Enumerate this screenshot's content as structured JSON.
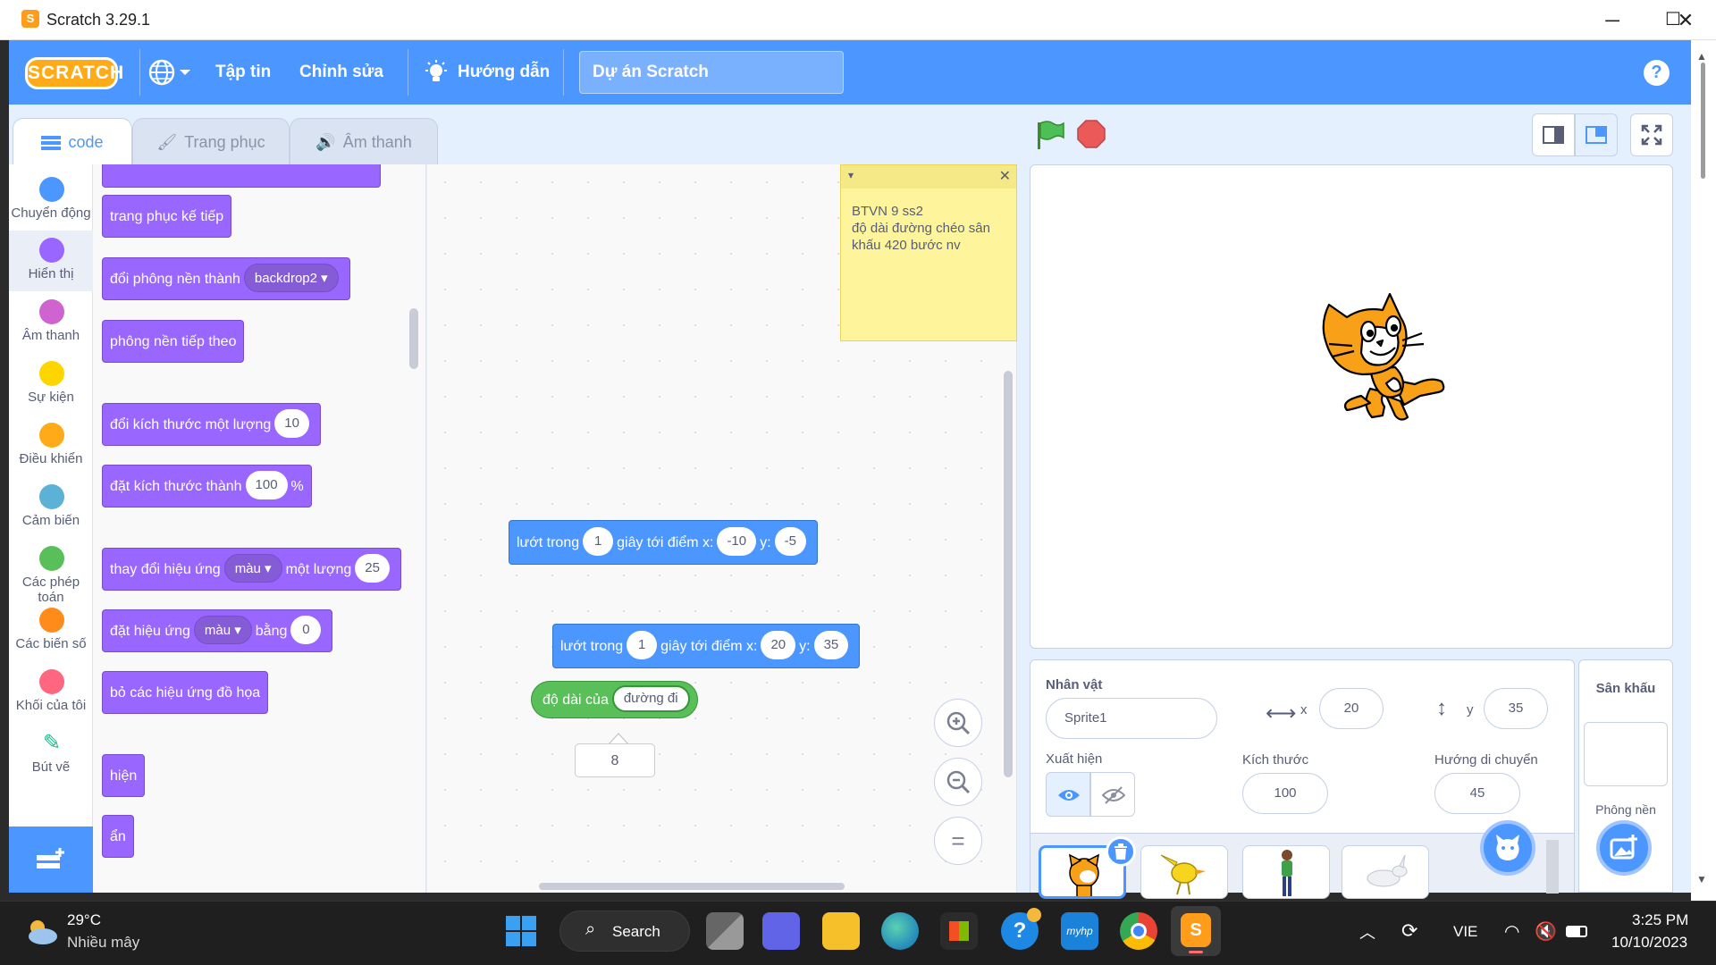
{
  "window": {
    "title": "Scratch 3.29.1",
    "minimize": "─",
    "maximize": "☐",
    "close": "✕"
  },
  "menubar": {
    "logo": "SCRATCH",
    "file": "Tập tin",
    "edit": "Chỉnh sửa",
    "tutorials": "Hướng dẫn",
    "project_title": "Dự án Scratch",
    "help": "?"
  },
  "tabs": {
    "code": "code",
    "costumes": "Trang phục",
    "sounds": "Âm thanh"
  },
  "categories": [
    {
      "label": "Chuyển động",
      "color": "#4c97ff"
    },
    {
      "label": "Hiển thị",
      "color": "#9966ff"
    },
    {
      "label": "Âm thanh",
      "color": "#cf63cf"
    },
    {
      "label": "Sự kiện",
      "color": "#ffd500"
    },
    {
      "label": "Điều khiển",
      "color": "#ffab19"
    },
    {
      "label": "Cảm biến",
      "color": "#5cb1d6"
    },
    {
      "label": "Các phép toán",
      "color": "#59c059"
    },
    {
      "label": "Các biến số",
      "color": "#ff8c1a"
    },
    {
      "label": "Khối của tôi",
      "color": "#ff6680"
    },
    {
      "label": "Bút vẽ",
      "color": "#0fbd8c"
    }
  ],
  "palette": {
    "next_costume": "trang phục kế tiếp",
    "switch_backdrop": "đổi phông nền thành",
    "backdrop_value": "backdrop2",
    "next_backdrop": "phông nền tiếp theo",
    "change_size": "đổi kích thước một lượng",
    "change_size_value": "10",
    "set_size": "đặt kích thước thành",
    "set_size_value": "100",
    "set_size_unit": "%",
    "change_effect": "thay đổi hiệu ứng",
    "effect_color": "màu",
    "change_effect_by": "một lượng",
    "change_effect_value": "25",
    "set_effect": "đặt hiệu ứng",
    "set_effect_to": "bằng",
    "set_effect_value": "0",
    "clear_effects": "bỏ các hiệu ứng đồ họa",
    "show": "hiện",
    "hide": "ẩn"
  },
  "workspace": {
    "note_text": "BTVN 9 ss2\nđộ dài đường chéo sân khấu 420 bước nv",
    "glide1": {
      "prefix": "lướt trong",
      "secs": "1",
      "mid": "giây tới điểm x:",
      "x": "-10",
      "ylabel": "y:",
      "y": "-5"
    },
    "glide2": {
      "prefix": "lướt trong",
      "secs": "1",
      "mid": "giây tới điểm x:",
      "x": "20",
      "ylabel": "y:",
      "y": "35"
    },
    "length_block": {
      "label": "độ dài của",
      "value": "đường đi"
    },
    "result_bubble": "8",
    "zoom_in": "+",
    "zoom_out": "−",
    "zoom_reset": "="
  },
  "sprite_info": {
    "sprite_label": "Nhân vật",
    "sprite_name": "Sprite1",
    "x_label": "x",
    "x_value": "20",
    "y_label": "y",
    "y_value": "35",
    "show_label": "Xuất hiện",
    "size_label": "Kích thước",
    "size_value": "100",
    "direction_label": "Hướng di chuyển",
    "direction_value": "45"
  },
  "stage_pane": {
    "title": "Sân khấu",
    "backdrops_label": "Phông nền"
  },
  "taskbar": {
    "weather_temp": "29°C",
    "weather_desc": "Nhiều mây",
    "search": "Search",
    "lang": "VIE",
    "time": "3:25 PM",
    "date": "10/10/2023"
  }
}
